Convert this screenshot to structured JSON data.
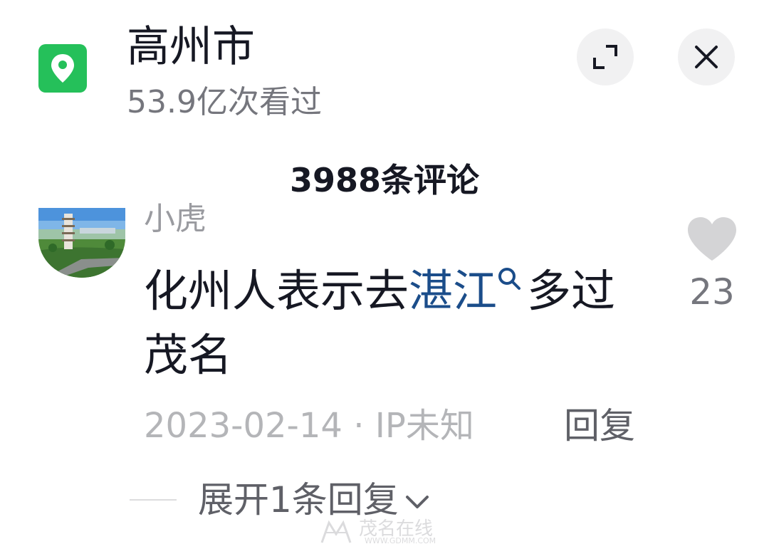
{
  "header": {
    "title": "高州市",
    "views": "53.9亿次看过",
    "icons": {
      "location": "location-pin-icon",
      "expand": "expand-icon",
      "close": "close-icon"
    }
  },
  "comments": {
    "count_label": "3988条评论",
    "items": [
      {
        "username": "小虎",
        "text_before": "化州人表示去",
        "keyword": "湛江",
        "text_after": "多过茂名",
        "date": "2023-02-14",
        "separator": "·",
        "ip": "IP未知",
        "reply_label": "回复",
        "likes": "23",
        "expand_label": "展开1条回复"
      }
    ]
  },
  "watermark": {
    "text": "茂名在线",
    "url": "WWW.GDMM.COM"
  },
  "colors": {
    "brand_green": "#25c05a",
    "keyword_blue": "#1b4d8a",
    "primary_text": "#161823",
    "secondary_text": "#75767d",
    "muted_text": "#b4b5b8",
    "like_heart": "#d4d4d6"
  }
}
